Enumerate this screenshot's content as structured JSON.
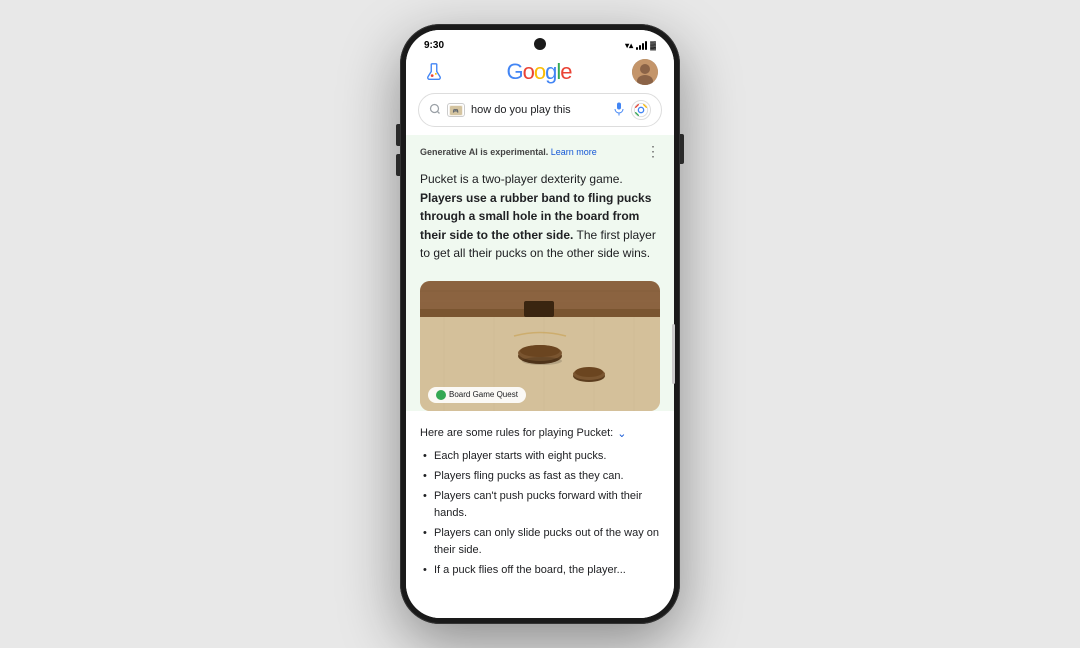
{
  "phone": {
    "status": {
      "time": "9:30",
      "wifi": "▼▲",
      "signal": "▌▌▌▌",
      "battery": "▓"
    }
  },
  "header": {
    "logo": "Google",
    "flask_label": "flask-icon",
    "avatar_label": "user-avatar"
  },
  "search": {
    "query": "how do you play this",
    "mic_label": "voice search",
    "lens_label": "visual search"
  },
  "ai_result": {
    "label": "Generative AI is experimental.",
    "learn_more": "Learn more",
    "intro": "Pucket is a two-player dexterity game.",
    "bold_part": "Players use a rubber band to fling pucks through a small hole in the board from their side to the other side.",
    "rest": "The first player to get all their pucks on the other side wins.",
    "image_source": "Board Game Quest"
  },
  "rules": {
    "header": "Here are some rules for playing Pucket:",
    "items": [
      "Each player starts with eight pucks.",
      "Players fling pucks as fast as they can.",
      "Players can't push pucks forward with their hands.",
      "Players can only slide pucks out of the way on their side.",
      "If a puck flies off the board, the player..."
    ]
  }
}
